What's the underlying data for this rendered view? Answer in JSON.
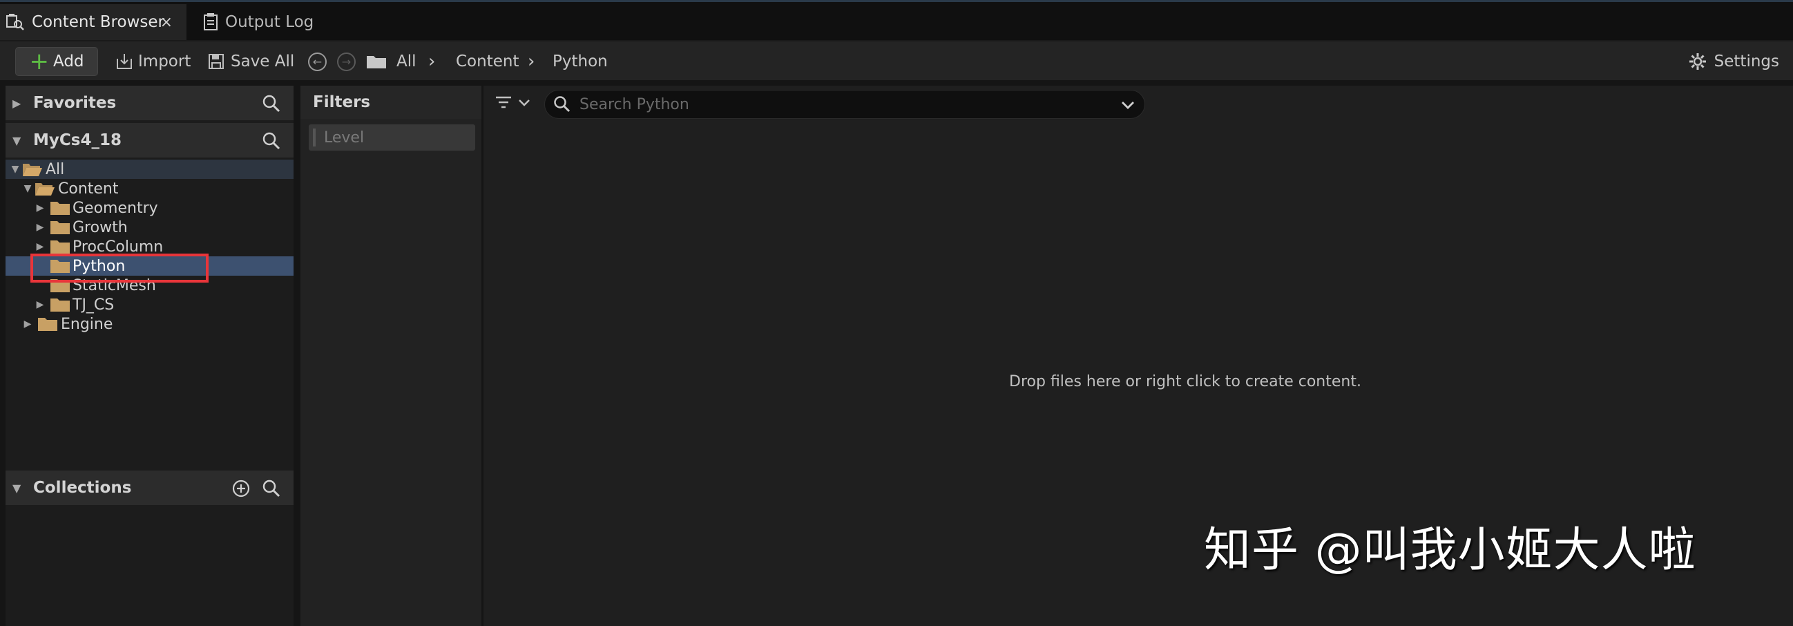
{
  "tabs": [
    {
      "label": "Content Browser",
      "icon": "content-browser-icon",
      "close": "×"
    },
    {
      "label": "Output Log",
      "icon": "output-log-icon"
    }
  ],
  "toolbar": {
    "add_label": "Add",
    "import_label": "Import",
    "save_all_label": "Save All",
    "settings_label": "Settings"
  },
  "breadcrumb": [
    "All",
    "Content",
    "Python"
  ],
  "favorites": {
    "label": "Favorites"
  },
  "project": {
    "label": "MyCs4_18"
  },
  "tree": [
    {
      "label": "All",
      "depth": 0,
      "expanded": true,
      "open": true
    },
    {
      "label": "Content",
      "depth": 1,
      "expanded": true,
      "open": true
    },
    {
      "label": "Geomentry",
      "depth": 2,
      "expanded": false
    },
    {
      "label": "Growth",
      "depth": 2,
      "expanded": false
    },
    {
      "label": "ProcColumn",
      "depth": 2,
      "expanded": false
    },
    {
      "label": "Python",
      "depth": 2,
      "selected": true
    },
    {
      "label": "StaticMesh",
      "depth": 2
    },
    {
      "label": "TJ_CS",
      "depth": 2,
      "expanded": false
    },
    {
      "label": "Engine",
      "depth": 1,
      "expanded": false
    }
  ],
  "collections": {
    "label": "Collections"
  },
  "filters": {
    "title": "Filters",
    "level_chip": "Level"
  },
  "search": {
    "placeholder": "Search Python",
    "value": ""
  },
  "empty_message": "Drop files here or right click to create content.",
  "watermark": "知乎 @叫我小姬大人啦",
  "colors": {
    "accent_green": "#5dbb44",
    "selection": "#3d5170",
    "folder": "#c8a064",
    "highlight_box": "#e8353a"
  }
}
